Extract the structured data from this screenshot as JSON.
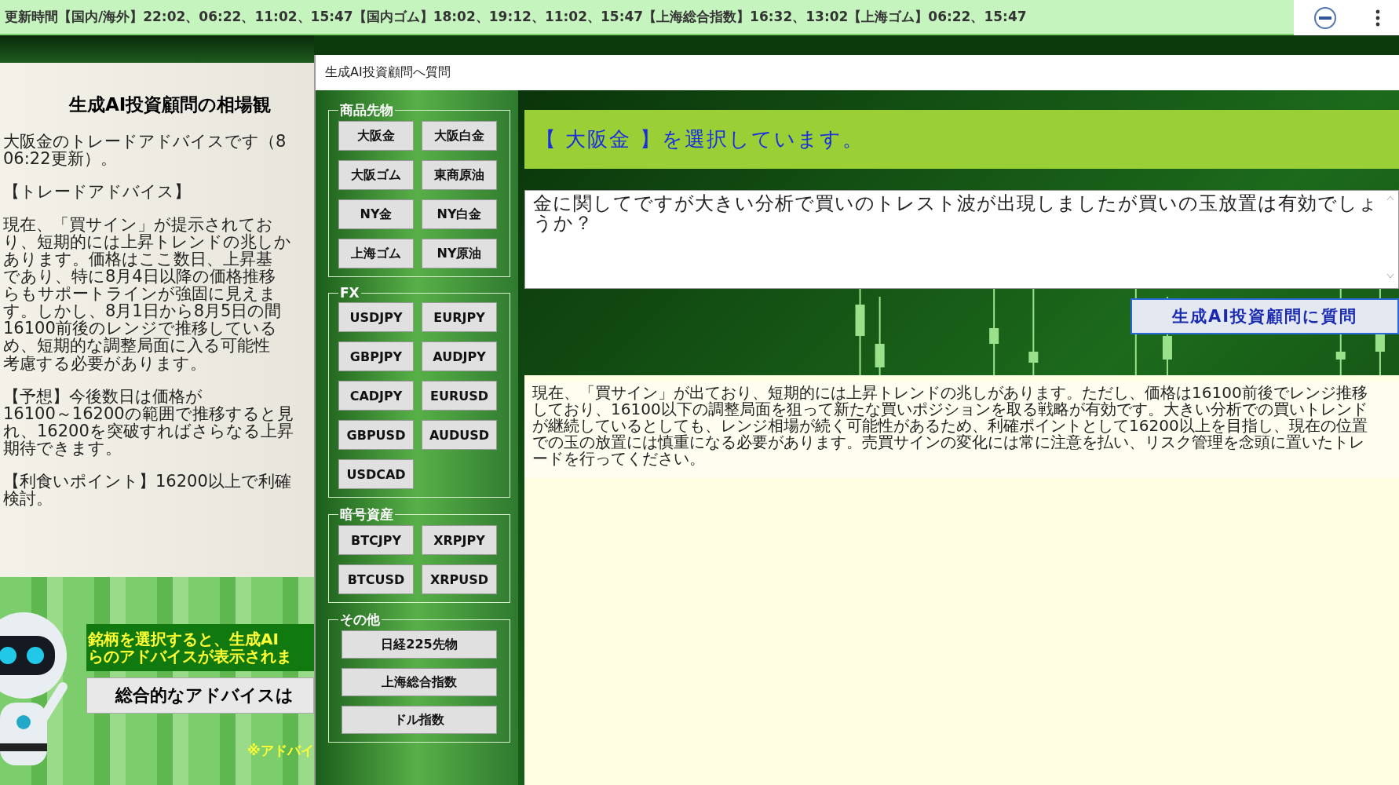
{
  "update_bar": {
    "text": "更新時間【国内/海外】22:02、06:22、11:02、15:47【国内ゴム】18:02、19:12、11:02、15:47【上海総合指数】16:32、13:02【上海ゴム】06:22、15:47"
  },
  "left_panel": {
    "title": "生成AI投資顧問の相場観",
    "paragraphs": [
      [
        "大阪金のトレードアドバイスです（8",
        "06:22更新）。"
      ],
      [
        "【トレードアドバイス】"
      ],
      [
        "現在、「買サイン」が提示されてお",
        "り、短期的には上昇トレンドの兆しか",
        "あります。価格はここ数日、上昇基",
        "であり、特に8月4日以降の価格推移",
        "らもサポートラインが強固に見えま",
        "す。しかし、8月1日から8月5日の間",
        "16100前後のレンジで推移している",
        "め、短期的な調整局面に入る可能性",
        "考慮する必要があります。"
      ],
      [
        "【予想】今後数日は価格が",
        "16100～16200の範囲で推移すると見",
        "れ、16200を突破すればさらなる上昇",
        "期待できます。"
      ],
      [
        "【利食いポイント】16200以上で利確",
        "検討。"
      ]
    ]
  },
  "promo": {
    "banner": [
      "銘柄を選択すると、生成AI",
      "らのアドバイスが表示されま"
    ],
    "button": "総合的なアドバイスは",
    "note": "※アドバイ"
  },
  "dialog": {
    "title": "生成AI投資顧問へ質問",
    "groups": [
      {
        "label": "商品先物",
        "kind": "grid",
        "buttons": [
          "大阪金",
          "大阪白金",
          "大阪ゴム",
          "東商原油",
          "NY金",
          "NY白金",
          "上海ゴム",
          "NY原油"
        ]
      },
      {
        "label": "FX",
        "kind": "grid",
        "buttons": [
          "USDJPY",
          "EURJPY",
          "GBPJPY",
          "AUDJPY",
          "CADJPY",
          "EURUSD",
          "GBPUSD",
          "AUDUSD",
          "USDCAD"
        ]
      },
      {
        "label": "暗号資産",
        "kind": "grid",
        "buttons": [
          "BTCJPY",
          "XRPJPY",
          "BTCUSD",
          "XRPUSD"
        ]
      },
      {
        "label": "その他",
        "kind": "wide",
        "buttons": [
          "日経225先物",
          "上海総合指数",
          "ドル指数"
        ]
      }
    ],
    "selection_banner": "【 大阪金 】を選択しています。",
    "question": {
      "value": "金に関してですが大きい分析で買いのトレスト波が出現しましたが買いの玉放置は有効でしょうか？"
    },
    "ask_button": "生成AI投資顧問に質問",
    "answer": "現在、「買サイン」が出ており、短期的には上昇トレンドの兆しがあります。ただし、価格は16100前後でレンジ推移しており、16100以下の調整局面を狙って新たな買いポジションを取る戦略が有効です。大きい分析での買いトレンドが継続しているとしても、レンジ相場が続く可能性があるため、利確ポイントとして16200以上を目指し、現在の位置での玉の放置には慎重になる必要があります。売買サインの変化には常に注意を払い、リスク管理を念頭に置いたトレードを行ってください。"
  }
}
